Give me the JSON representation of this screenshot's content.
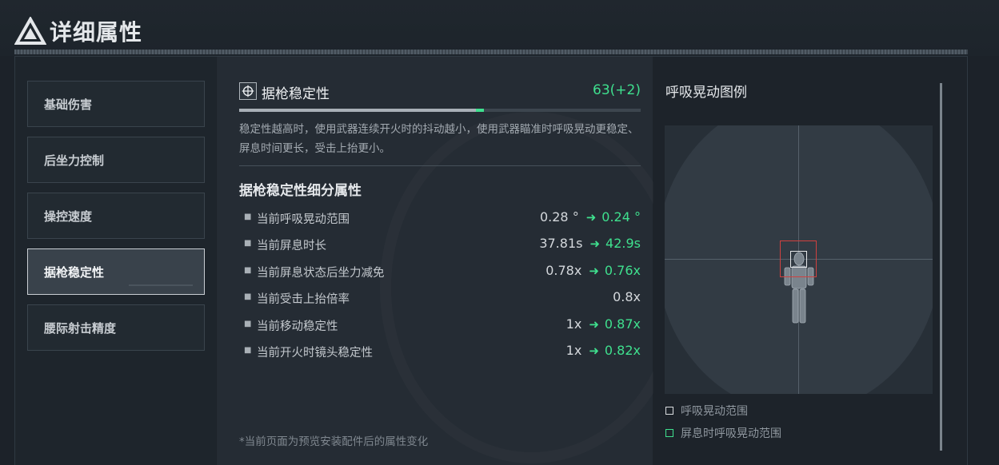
{
  "header": {
    "title": "详细属性"
  },
  "nav": {
    "items": [
      {
        "label": "基础伤害",
        "active": false
      },
      {
        "label": "后坐力控制",
        "active": false
      },
      {
        "label": "操控速度",
        "active": false
      },
      {
        "label": "据枪稳定性",
        "active": true
      },
      {
        "label": "腰际射击精度",
        "active": false
      }
    ]
  },
  "stat": {
    "icon": "crosshair-icon",
    "name": "据枪稳定性",
    "value": "63(+2)",
    "bar": {
      "base": 0.59,
      "gain": 0.02
    }
  },
  "description": "稳定性越高时，使用武器连续开火时的抖动越小，使用武器瞄准时呼吸晃动更稳定、屏息时间更长，受击上抬更小。",
  "sub_section": {
    "title": "据枪稳定性细分属性",
    "attributes": [
      {
        "label": "当前呼吸晃动范围",
        "current": "0.28 °",
        "new": "0.24 °"
      },
      {
        "label": "当前屏息时长",
        "current": "37.81s",
        "new": "42.9s"
      },
      {
        "label": "当前屏息状态后坐力减免",
        "current": "0.78x",
        "new": "0.76x"
      },
      {
        "label": "当前受击上抬倍率",
        "current": "0.8x",
        "new": ""
      },
      {
        "label": "当前移动稳定性",
        "current": "1x",
        "new": "0.87x"
      },
      {
        "label": "当前开火时镜头稳定性",
        "current": "1x",
        "new": "0.82x"
      }
    ],
    "arrow": "➜"
  },
  "footnote": "*当前页面为预览安装配件后的属性变化",
  "legend": {
    "title": "呼吸晃动图例",
    "items": [
      {
        "label": "呼吸晃动范围",
        "color": "#d9dcdf"
      },
      {
        "label": "屏息时呼吸晃动范围",
        "color": "#3fe08e"
      }
    ]
  },
  "colors": {
    "accent_green": "#3fe08e",
    "sway_red": "#d0413f"
  }
}
